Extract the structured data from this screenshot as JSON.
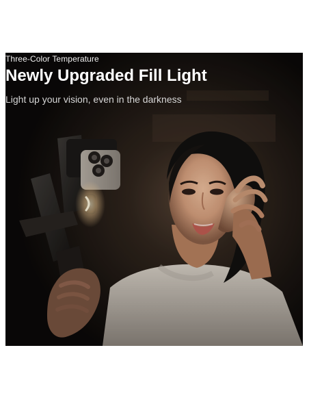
{
  "hero": {
    "eyebrow": "Three-Color Temperature",
    "headline": "Newly Upgraded Fill Light",
    "subline": "Light up your vision, even in the darkness"
  },
  "colors": {
    "page_background": "#ffffff",
    "photo_background": "#120f0c",
    "headline_text": "#ffffff",
    "subline_text": "#d7d7d7",
    "fill_light_glow": "#ffd59a"
  }
}
